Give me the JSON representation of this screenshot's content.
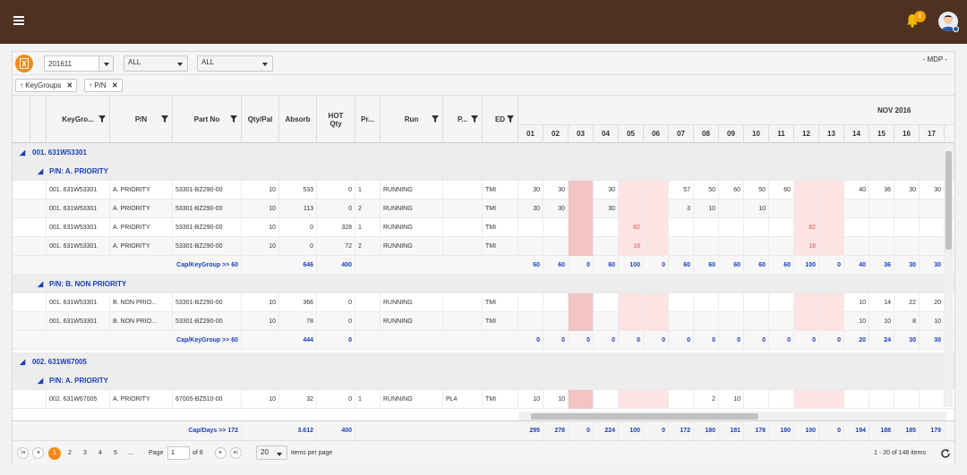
{
  "topbar": {
    "notification_count": "0"
  },
  "toolbar": {
    "period": "201611",
    "filter1": "ALL",
    "filter2": "ALL",
    "site": "- MDP -"
  },
  "group_chips": [
    {
      "label": "KeyGroups"
    },
    {
      "label": "P/N"
    }
  ],
  "columns": {
    "keygroup": "KeyGro...",
    "pn": "P/N",
    "part_no": "Part No",
    "qty_pal": "Qty/Pal",
    "absorb": "Absorb",
    "hot_qty": "HOT Qty",
    "pr": "Pr...",
    "run": "Run",
    "p": "P...",
    "ed": "ED",
    "month": "NOV 2016",
    "days": [
      "01",
      "02",
      "03",
      "04",
      "05",
      "06",
      "07",
      "08",
      "09",
      "10",
      "11",
      "12",
      "13",
      "14",
      "15",
      "16",
      "17"
    ]
  },
  "groups": {
    "g1": "001. 631W53301",
    "g1_sub1": "P/N: A. PRIORITY",
    "g1_sub2": "P/N: B. NON PRIORITY",
    "g2": "002. 631W67005",
    "g2_sub1": "P/N: A. PRIORITY"
  },
  "rows": [
    {
      "keygroup": "001. 631W53301",
      "pn": "A. PRIORITY",
      "part_no": "53301-BZ290-00",
      "qty_pal": "10",
      "absorb": "533",
      "hot_qty": "0",
      "pr": "1",
      "run": "RUNNING",
      "p": "",
      "ed": "TMI",
      "days": [
        "30",
        "30",
        "",
        "30",
        "",
        "",
        "57",
        "50",
        "60",
        "50",
        "60",
        "",
        "",
        "40",
        "36",
        "30",
        "30"
      ]
    },
    {
      "keygroup": "001. 631W53301",
      "pn": "A. PRIORITY",
      "part_no": "53301-BZ290-00",
      "qty_pal": "10",
      "absorb": "113",
      "hot_qty": "0",
      "pr": "2",
      "run": "RUNNING",
      "p": "",
      "ed": "TMI",
      "days": [
        "30",
        "30",
        "",
        "30",
        "",
        "",
        "3",
        "10",
        "",
        "10",
        "",
        "",
        "",
        "",
        "",
        "",
        ""
      ]
    },
    {
      "keygroup": "001. 631W53301",
      "pn": "A. PRIORITY",
      "part_no": "53301-BZ290-00",
      "qty_pal": "10",
      "absorb": "0",
      "hot_qty": "328",
      "pr": "1",
      "run": "RUNNING",
      "p": "",
      "ed": "TMI",
      "days": [
        "",
        "",
        "",
        "",
        "82",
        "",
        "",
        "",
        "",
        "",
        "",
        "82",
        "",
        "",
        "",
        "",
        ""
      ]
    },
    {
      "keygroup": "001. 631W53301",
      "pn": "A. PRIORITY",
      "part_no": "53301-BZ290-00",
      "qty_pal": "10",
      "absorb": "0",
      "hot_qty": "72",
      "pr": "2",
      "run": "RUNNING",
      "p": "",
      "ed": "TMI",
      "days": [
        "",
        "",
        "",
        "",
        "18",
        "",
        "",
        "",
        "",
        "",
        "",
        "18",
        "",
        "",
        "",
        "",
        ""
      ]
    },
    {
      "keygroup": "001. 631W53301",
      "pn": "B. NON PRIO...",
      "part_no": "53301-BZ290-00",
      "qty_pal": "10",
      "absorb": "366",
      "hot_qty": "0",
      "pr": "",
      "run": "RUNNING",
      "p": "",
      "ed": "TMI",
      "days": [
        "",
        "",
        "",
        "",
        "",
        "",
        "",
        "",
        "",
        "",
        "",
        "",
        "",
        "10",
        "14",
        "22",
        "20"
      ]
    },
    {
      "keygroup": "001. 631W53301",
      "pn": "B. NON PRIO...",
      "part_no": "53301-BZ290-00",
      "qty_pal": "10",
      "absorb": "78",
      "hot_qty": "0",
      "pr": "",
      "run": "RUNNING",
      "p": "",
      "ed": "TMI",
      "days": [
        "",
        "",
        "",
        "",
        "",
        "",
        "",
        "",
        "",
        "",
        "",
        "",
        "",
        "10",
        "10",
        "8",
        "10"
      ]
    },
    {
      "keygroup": "002. 631W67005",
      "pn": "A. PRIORITY",
      "part_no": "67005-BZ510-00",
      "qty_pal": "10",
      "absorb": "32",
      "hot_qty": "0",
      "pr": "1",
      "run": "RUNNING",
      "p": "PL4",
      "ed": "TMI",
      "days": [
        "10",
        "10",
        "",
        "",
        "",
        "",
        "",
        "2",
        "10",
        "",
        "",
        "",
        "",
        "",
        "",
        "",
        ""
      ]
    }
  ],
  "footers": {
    "f1": {
      "label": "Cap/KeyGroup >> 60",
      "absorb": "646",
      "hot_qty": "400",
      "days": [
        "60",
        "60",
        "0",
        "60",
        "100",
        "0",
        "60",
        "60",
        "60",
        "60",
        "60",
        "100",
        "0",
        "40",
        "36",
        "30",
        "30"
      ]
    },
    "f2": {
      "label": "Cap/KeyGroup >> 60",
      "absorb": "444",
      "hot_qty": "0",
      "days": [
        "0",
        "0",
        "0",
        "0",
        "0",
        "0",
        "0",
        "0",
        "0",
        "0",
        "0",
        "0",
        "0",
        "20",
        "24",
        "30",
        "30"
      ]
    },
    "total": {
      "label": "Cap/Days >> 172",
      "absorb": "3.612",
      "hot_qty": "400",
      "days": [
        "295",
        "278",
        "0",
        "224",
        "100",
        "0",
        "172",
        "180",
        "181",
        "178",
        "180",
        "100",
        "0",
        "194",
        "188",
        "185",
        "179"
      ]
    }
  },
  "pager": {
    "pages": [
      "1",
      "2",
      "3",
      "4",
      "5",
      "..."
    ],
    "page_label": "Page",
    "page_value": "1",
    "of_label": "of 8",
    "page_size": "20",
    "items_label": "items per page",
    "summary": "1 - 20 of 148 items"
  }
}
